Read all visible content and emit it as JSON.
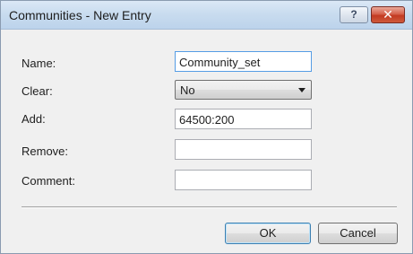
{
  "window": {
    "title": "Communities - New Entry",
    "help_label": "?",
    "close_label": "✕"
  },
  "form": {
    "name": {
      "label": "Name:",
      "value": "Community_set"
    },
    "clear": {
      "label": "Clear:",
      "selected": "No"
    },
    "add": {
      "label": "Add:",
      "value": "64500:200"
    },
    "remove": {
      "label": "Remove:",
      "value": ""
    },
    "comment": {
      "label": "Comment:",
      "value": ""
    }
  },
  "buttons": {
    "ok_label": "OK",
    "cancel_label": "Cancel"
  },
  "colors": {
    "titlebar": "#c9dcef",
    "close_button": "#c23a22",
    "dialog_background": "#f0f0f0"
  }
}
